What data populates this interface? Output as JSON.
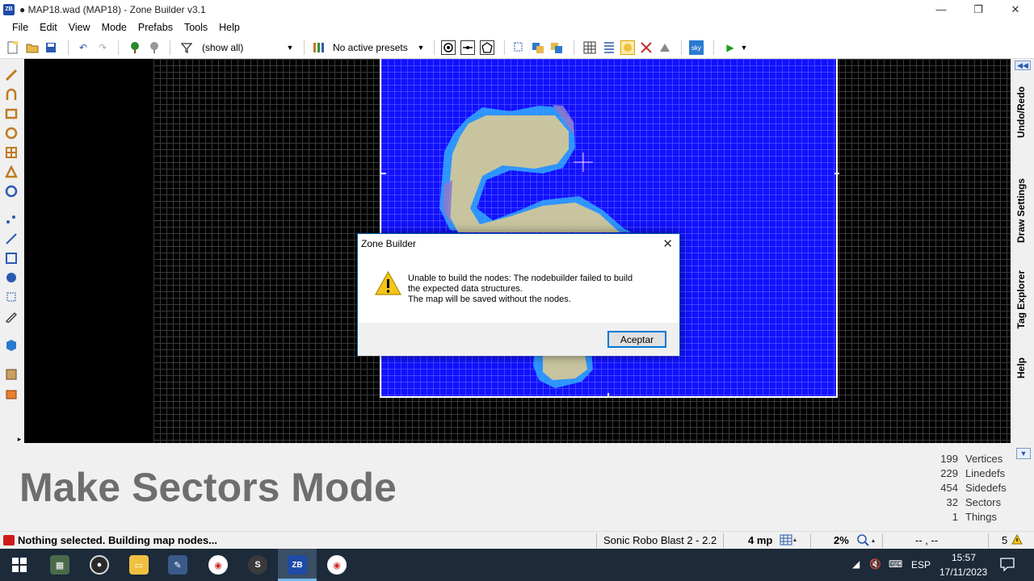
{
  "window": {
    "title": "● MAP18.wad (MAP18) - Zone Builder v3.1",
    "minimize": "—",
    "maximize": "❐",
    "close": "✕"
  },
  "menu": [
    "File",
    "Edit",
    "View",
    "Mode",
    "Prefabs",
    "Tools",
    "Help"
  ],
  "toolbar": {
    "filter_label": "(show all)",
    "presets_label": "No active presets"
  },
  "right_dock": {
    "tabs": [
      "Undo/Redo",
      "Draw Settings",
      "Tag Explorer",
      "Help"
    ]
  },
  "info_panel": {
    "mode_title": "Make Sectors Mode",
    "stats": [
      {
        "value": "199",
        "label": "Vertices"
      },
      {
        "value": "229",
        "label": "Linedefs"
      },
      {
        "value": "454",
        "label": "Sidedefs"
      },
      {
        "value": "32",
        "label": "Sectors"
      },
      {
        "value": "1",
        "label": "Things"
      }
    ]
  },
  "status_bar": {
    "message": "Nothing selected. Building map nodes...",
    "game_config": "Sonic Robo Blast 2 - 2.2",
    "grid_size": "4 mp",
    "zoom": "2%",
    "coordinates": "-- , --",
    "warnings": "5"
  },
  "dialog": {
    "title": "Zone Builder",
    "message_line1": "Unable to build the nodes: The nodebuilder failed to build",
    "message_line2": "the expected data structures.",
    "message_line3": "The map will be saved without the nodes.",
    "ok_label": "Aceptar"
  },
  "taskbar": {
    "language": "ESP",
    "time": "15:57",
    "date": "17/11/2023"
  },
  "colors": {
    "map_fill": "#1111ff",
    "sector_floor": "#c8c4a0",
    "water": "#33aaff",
    "dialog_accent": "#0078d7",
    "taskbar_bg": "#1c2a3a"
  }
}
